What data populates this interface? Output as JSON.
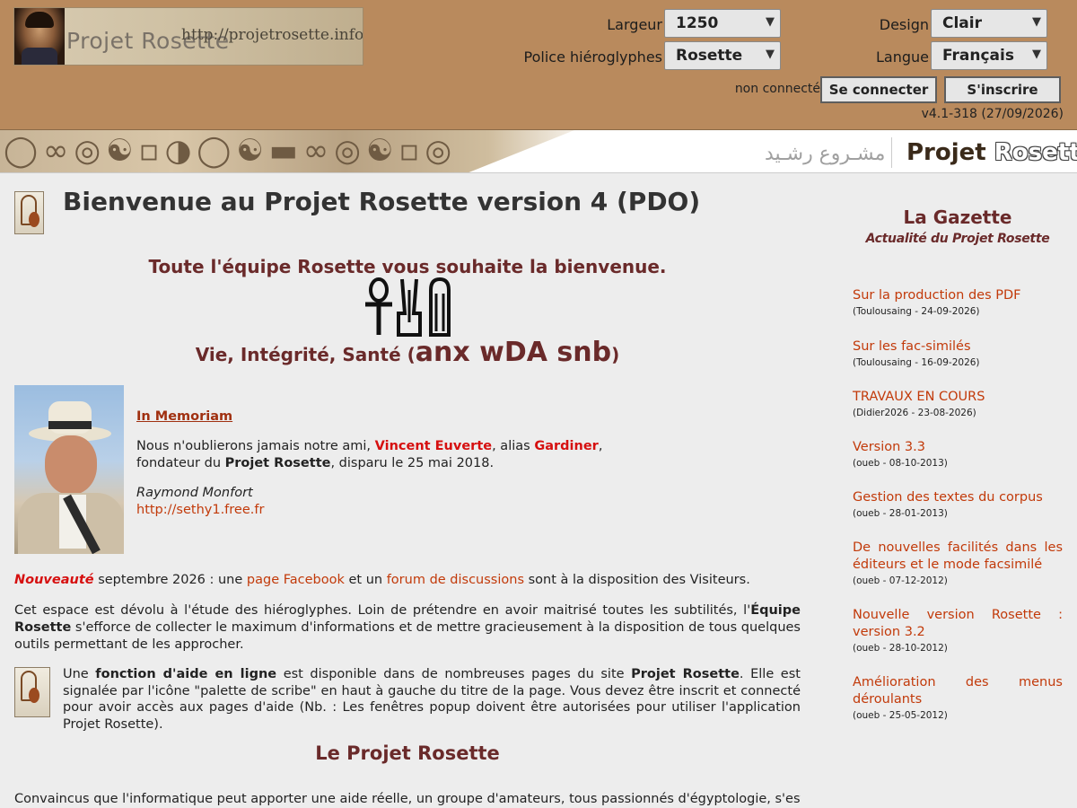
{
  "header": {
    "logo_text": "Projet Rosette",
    "logo_url": "http://projetrosette.info",
    "largeur_label": "Largeur",
    "largeur_value": "1250",
    "police_label": "Police hiéroglyphes",
    "police_value": "Rosette",
    "design_label": "Design",
    "design_value": "Clair",
    "langue_label": "Langue",
    "langue_value": "Français",
    "status": "non connecté",
    "login_label": "Se connecter",
    "signup_label": "S'inscrire",
    "version": "v4.1-318 (27/09/2026)"
  },
  "banner": {
    "arabic": "مشـروع رشـيد",
    "brand_1": "Projet",
    "brand_2": "Rosette"
  },
  "main": {
    "title": "Bienvenue au Projet Rosette version 4 (PDO)",
    "welcome": "Toute l'équipe Rosette vous souhaite la bienvenue.",
    "blessing_text": "Vie, Intégrité, Santé (",
    "blessing_translit": "anx wDA snb",
    "blessing_close": ")",
    "memoriam": {
      "heading": "In Memoriam",
      "l1_a": "Nous n'oublierons jamais notre ami, ",
      "l1_name": "Vincent Euverte",
      "l1_b": ", alias ",
      "l1_alias": "Gardiner",
      "l1_c": ",",
      "l2_a": "fondateur du ",
      "l2_bold": "Projet Rosette",
      "l2_b": ", disparu le 25 mai 2018.",
      "author": "Raymond Monfort",
      "url": "http://sethy1.free.fr"
    },
    "nouveaute": {
      "tag": "Nouveauté",
      "t1": " septembre 2026 : une ",
      "link1": "page Facebook",
      "t2": " et un ",
      "link2": "forum de discussions",
      "t3": " sont à la disposition des Visiteurs."
    },
    "espace": {
      "t1": "Cet espace est dévolu à l'étude des hiéroglyphes. Loin de prétendre en avoir maitrisé toutes les subtilités, l'",
      "bold": "Équipe Rosette",
      "t2": " s'efforce de collecter le maximum d'informations et de mettre gracieusement à la disposition de tous quelques outils permettant de les approcher."
    },
    "aide": {
      "t1": "Une ",
      "bold1": "fonction d'aide en ligne",
      "t2": " est disponible dans de nombreuses pages du site ",
      "bold2": "Projet Rosette",
      "t3": ". Elle est signalée par l'icône \"palette de scribe\" en haut à gauche du titre de la page. Vous devez être inscrit et connecté pour avoir accès aux pages d'aide (Nb. : Les fenêtres popup doivent être autorisées pour utiliser l'application Projet Rosette)."
    },
    "section_title": "Le Projet Rosette",
    "convaincus": "Convaincus que l'informatique peut apporter une aide réelle, un groupe d'amateurs, tous passionnés d'égyptologie, s'est lancé"
  },
  "gazette": {
    "title": "La Gazette",
    "subtitle": "Actualité du Projet Rosette",
    "items": [
      {
        "title": "Sur la production des PDF",
        "meta": "(Toulousaing - 24-09-2026)"
      },
      {
        "title": "Sur les fac-similés",
        "meta": "(Toulousaing - 16-09-2026)"
      },
      {
        "title": "TRAVAUX EN COURS",
        "meta": "(Didier2026 - 23-08-2026)"
      },
      {
        "title": "Version 3.3",
        "meta": "(oueb - 08-10-2013)"
      },
      {
        "title": "Gestion des textes du corpus",
        "meta": "(oueb - 28-01-2013)"
      },
      {
        "title": "De nouvelles facilités dans les éditeurs et le mode facsimilé",
        "meta": "(oueb - 07-12-2012)"
      },
      {
        "title": "Nouvelle version Rosette : version 3.2",
        "meta": "(oueb - 28-10-2012)"
      },
      {
        "title": "Amélioration des menus déroulants",
        "meta": "(oueb - 25-05-2012)"
      }
    ]
  }
}
